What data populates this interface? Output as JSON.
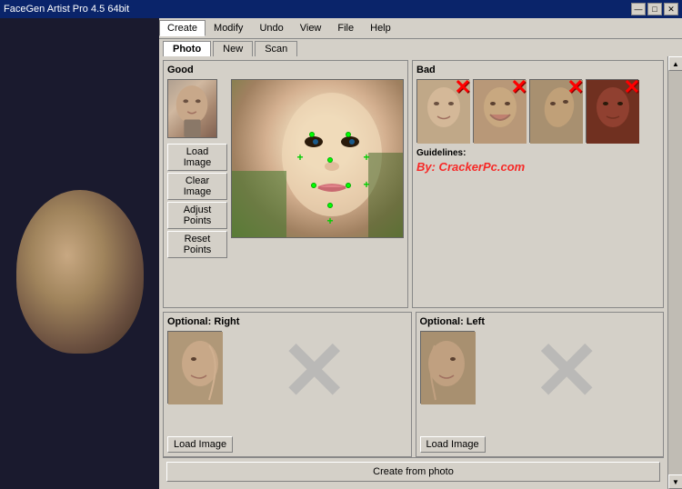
{
  "titleBar": {
    "title": "FaceGen Artist Pro 4.5 64bit",
    "minimize": "—",
    "maximize": "□",
    "close": "✕"
  },
  "menuBar": {
    "items": [
      "Create",
      "Modify",
      "Undo",
      "View",
      "File",
      "Help"
    ]
  },
  "tabs": {
    "items": [
      "Photo",
      "New",
      "Scan"
    ]
  },
  "goodPanel": {
    "label": "Good",
    "buttons": {
      "loadImage": "Load Image",
      "clearImage": "Clear Image",
      "adjustPoints": "Adjust Points",
      "resetPoints": "Reset Points"
    }
  },
  "badPanel": {
    "label": "Bad",
    "guidelines": "Guidelines:",
    "watermark": "By: CrackerPc.com"
  },
  "optionalRight": {
    "label": "Optional: Right",
    "loadImage": "Load Image"
  },
  "optionalLeft": {
    "label": "Optional: Left",
    "loadImage": "Load Image"
  },
  "createBtn": "Create from photo"
}
